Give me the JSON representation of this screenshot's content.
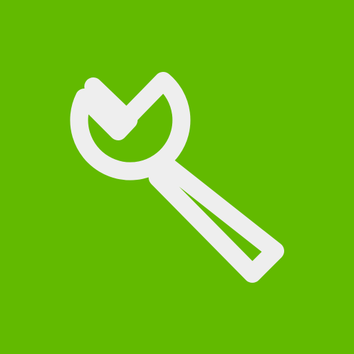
{
  "icon": {
    "name": "wrench-icon",
    "background_color": "#62BA00",
    "glyph_color": "#EEEEEE"
  }
}
